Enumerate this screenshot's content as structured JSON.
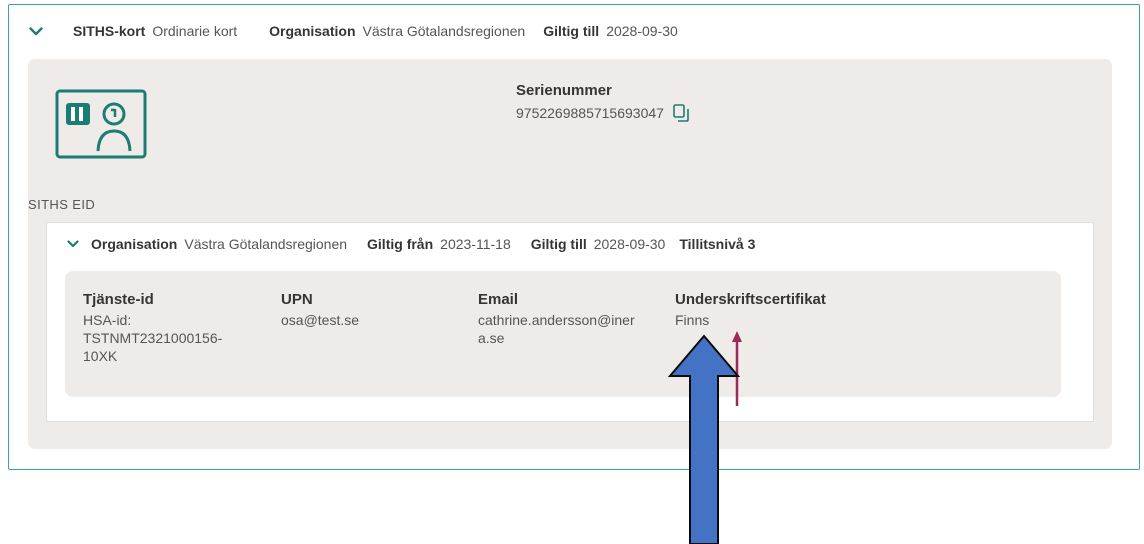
{
  "card": {
    "title_label": "SITHS-kort",
    "title_value": "Ordinarie kort",
    "org_label": "Organisation",
    "org_value": "Västra Götalandsregionen",
    "valid_to_label": "Giltig till",
    "valid_to_value": "2028-09-30"
  },
  "serial": {
    "title": "Serienummer",
    "value": "9752269885715693047"
  },
  "eid_section_label": "SITHS EID",
  "eid": {
    "org_label": "Organisation",
    "org_value": "Västra Götalandsregionen",
    "valid_from_label": "Giltig från",
    "valid_from_value": "2023-11-18",
    "valid_to_label": "Giltig till",
    "valid_to_value": "2028-09-30",
    "trust_level": "Tillitsnivå 3"
  },
  "details": {
    "service_id_label": "Tjänste-id",
    "service_id_lines": [
      "HSA-id:",
      "TSTNMT2321000156-",
      "10XK"
    ],
    "upn_label": "UPN",
    "upn_value": "osa@test.se",
    "email_label": "Email",
    "email_lines": [
      "cathrine.andersson@iner",
      "a.se"
    ],
    "signature_label": "Underskriftscertifikat",
    "signature_value": "Finns"
  },
  "colors": {
    "accent": "#1a7c72",
    "border": "#3aa5a0",
    "panel": "#efebe8",
    "annotation_red": "#9b2a5a",
    "annotation_blue": "#4472c4"
  },
  "icons": {
    "chevron": "chevron-down-icon",
    "card": "siths-card-icon",
    "copy": "copy-icon"
  }
}
